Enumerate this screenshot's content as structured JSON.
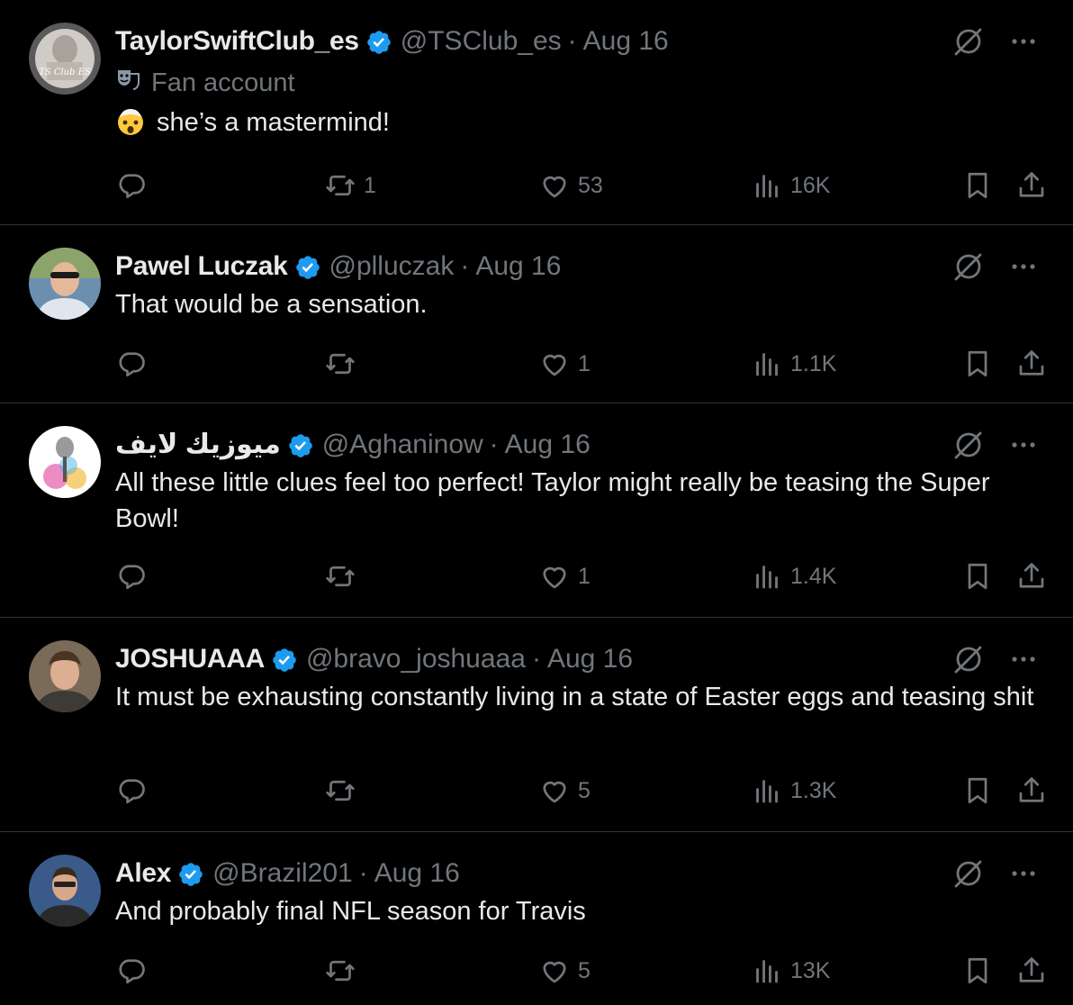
{
  "colors": {
    "background": "#000000",
    "text": "#e7e9ea",
    "muted": "#71767b",
    "verified": "#1d9bf0",
    "divider": "#2f3336"
  },
  "icons": {
    "reply": "speech-bubble-icon",
    "retweet": "retweet-icon",
    "like": "heart-icon",
    "views": "bar-chart-icon",
    "bookmark": "bookmark-icon",
    "share": "share-icon",
    "grok": "grok-icon",
    "more": "more-icon",
    "verified": "verified-badge-icon"
  },
  "tweets": [
    {
      "name": "TaylorSwiftClub_es",
      "handle": "@TSClub_es",
      "sep": "·",
      "date": "Aug 16",
      "label": "Fan account",
      "text": "she’s a mastermind!",
      "replies": "",
      "retweets": "1",
      "likes": "53",
      "views": "16K"
    },
    {
      "name": "Pawel Luczak",
      "handle": "@plluczak",
      "sep": "·",
      "date": "Aug 16",
      "text": "That would be a sensation.",
      "replies": "",
      "retweets": "",
      "likes": "1",
      "views": "1.1K"
    },
    {
      "name": "ميوزيك لايف",
      "handle": "@Aghaninow",
      "sep": "·",
      "date": "Aug 16",
      "text": "All these little clues feel too perfect! Taylor might really be teasing the Super Bowl!",
      "replies": "",
      "retweets": "",
      "likes": "1",
      "views": "1.4K"
    },
    {
      "name": "JOSHUAAA",
      "handle": "@bravo_joshuaaa",
      "sep": "·",
      "date": "Aug 16",
      "text": "It must be exhausting constantly living in a state of Easter eggs and teasing shit",
      "replies": "",
      "retweets": "",
      "likes": "5",
      "views": "1.3K"
    },
    {
      "name": "Alex",
      "handle": "@Brazil201",
      "sep": "·",
      "date": "Aug 16",
      "text": "And probably final NFL season for Travis",
      "replies": "",
      "retweets": "",
      "likes": "5",
      "views": "13K"
    }
  ]
}
